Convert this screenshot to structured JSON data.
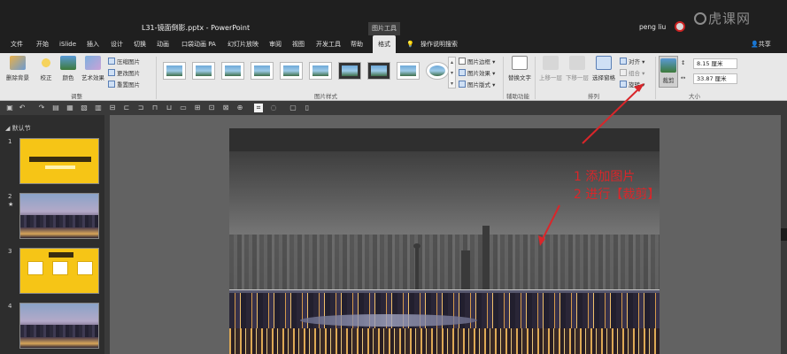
{
  "window": {
    "title": "L31-镜面倒影.pptx - PowerPoint",
    "context_tab_header": "图片工具",
    "user_name": "peng liu",
    "watermark": "虎课网"
  },
  "menu": {
    "tabs": [
      "文件",
      "开始",
      "iSlide",
      "插入",
      "设计",
      "切换",
      "动画",
      "口袋动画 PA",
      "幻灯片放映",
      "审阅",
      "视图",
      "开发工具",
      "帮助",
      "格式"
    ],
    "active_tab": "格式",
    "tell_me": "操作说明搜索",
    "share": "共享"
  },
  "ribbon": {
    "adjust": {
      "remove_bg": "删除背景",
      "correct": "校正",
      "color": "颜色",
      "art_effect": "艺术效果",
      "compress": "压缩图片",
      "change": "更改图片",
      "reset": "重置图片",
      "label": "调整"
    },
    "styles": {
      "border": "图片边框",
      "effects": "图片效果",
      "layout": "图片版式",
      "label": "图片样式"
    },
    "accessibility": {
      "alt_text": "替换文字",
      "label": "辅助功能"
    },
    "arrange": {
      "bring_forward": "上移一层",
      "send_backward": "下移一层",
      "selection_pane": "选择窗格",
      "align": "对齐",
      "group": "组合",
      "rotate": "旋转",
      "label": "排列"
    },
    "size": {
      "crop": "裁剪",
      "height": "8.15 厘米",
      "width": "33.87 厘米",
      "label": "大小"
    }
  },
  "slides_panel": {
    "section": "默认节",
    "slides": [
      {
        "num": "1",
        "star": ""
      },
      {
        "num": "2",
        "star": "★"
      },
      {
        "num": "3",
        "star": ""
      },
      {
        "num": "4",
        "star": ""
      }
    ]
  },
  "annotation": {
    "line1": "1 添加图片",
    "line2": "2 进行【裁剪】",
    "color": "#d9262a"
  }
}
